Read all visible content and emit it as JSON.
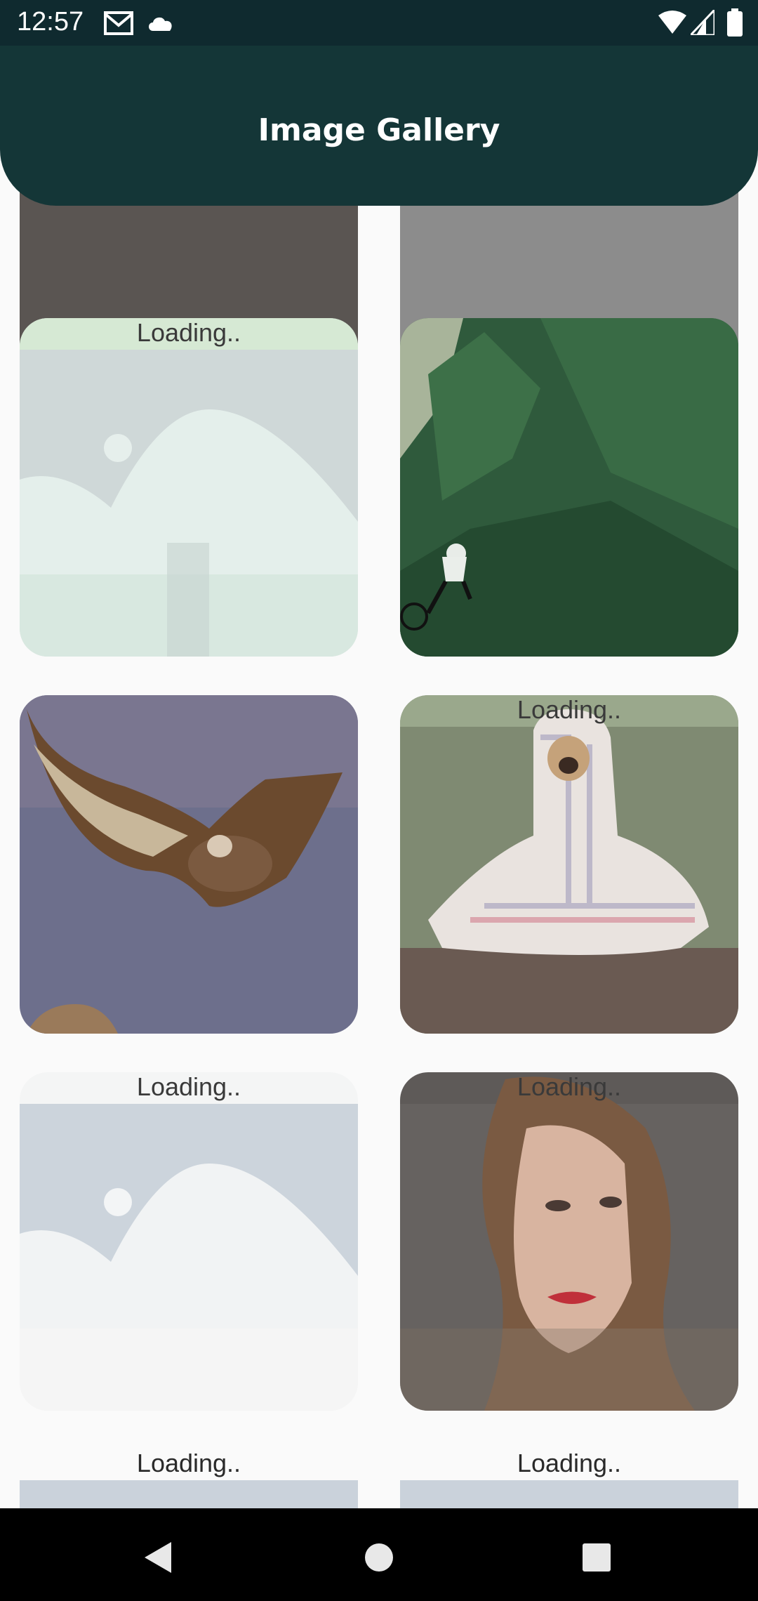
{
  "status_bar": {
    "time": "12:57",
    "left_icons": [
      "gmail-icon",
      "cloud-icon"
    ],
    "right_icons": [
      "wifi-icon",
      "signal-icon",
      "battery-icon"
    ]
  },
  "app_bar": {
    "title": "Image Gallery"
  },
  "gallery": {
    "loading_text": "Loading..",
    "tiles": [
      {
        "name": "rocky-ground-image"
      },
      {
        "name": "foggy-forest-image"
      },
      {
        "name": "placeholder-image",
        "loading": true
      },
      {
        "name": "forest-biker-image"
      },
      {
        "name": "vulture-image"
      },
      {
        "name": "pug-blanket-image",
        "loading": true
      },
      {
        "name": "placeholder-image",
        "loading": true
      },
      {
        "name": "woman-portrait-image",
        "loading": true
      },
      {
        "name": "placeholder-image",
        "loading": true
      },
      {
        "name": "placeholder-image",
        "loading": true
      }
    ]
  },
  "nav_bar": {
    "icons": [
      "back-icon",
      "home-icon",
      "recents-icon"
    ]
  }
}
